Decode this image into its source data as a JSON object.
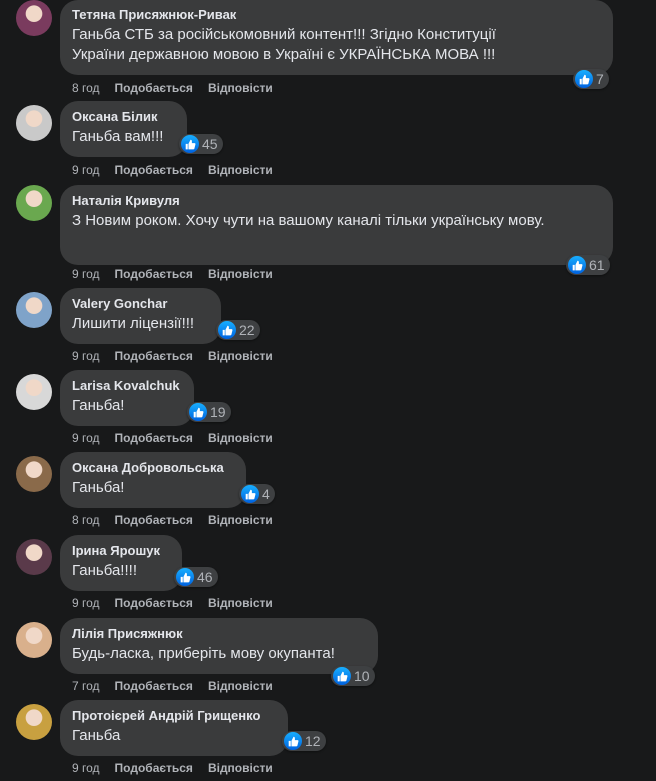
{
  "labels": {
    "like": "Подобається",
    "reply": "Відповісти"
  },
  "comments": [
    {
      "author": "Тетяна Присяжнюк-Ривак",
      "text": "Ганьба СТБ за російськомовний контент!!! Згідно Конституції України державною мовою в Україні є УКРАЇНСЬКА МОВА !!!",
      "reactions": "7",
      "time": "8 год",
      "avatar_color": "#7a3b5e"
    },
    {
      "author": "Оксана Білик",
      "text": "Ганьба вам!!!",
      "reactions": "45",
      "time": "9 год",
      "avatar_color": "#c9c9c9"
    },
    {
      "author": "Наталія Кривуля",
      "text": "З Новим роком. Хочу чути на вашому каналі тільки українську мову.",
      "reactions": "61",
      "time": "9 год",
      "avatar_color": "#6aa84f"
    },
    {
      "author": "Valery Gonchar",
      "text": "Лишити ліцензії!!!",
      "reactions": "22",
      "time": "9 год",
      "avatar_color": "#7fa3c9"
    },
    {
      "author": "Larisa Kovalchuk",
      "text": "Ганьба!",
      "reactions": "19",
      "time": "9 год",
      "avatar_color": "#d8d8d8"
    },
    {
      "author": "Оксана Добровольська",
      "text": "Ганьба!",
      "reactions": "4",
      "time": "8 год",
      "avatar_color": "#8a6a4a"
    },
    {
      "author": "Ірина Ярошук",
      "text": "Ганьба!!!!",
      "reactions": "46",
      "time": "9 год",
      "avatar_color": "#5a3a4a"
    },
    {
      "author": "Лілія Присяжнюк",
      "text": "Будь-ласка, приберіть мову окупанта!",
      "reactions": "10",
      "time": "7 год",
      "avatar_color": "#d9b08c"
    },
    {
      "author": "Протоієрей Андрій Грищенко",
      "text": "Ганьба",
      "reactions": "12",
      "time": "9 год",
      "avatar_color": "#c8a040"
    }
  ]
}
